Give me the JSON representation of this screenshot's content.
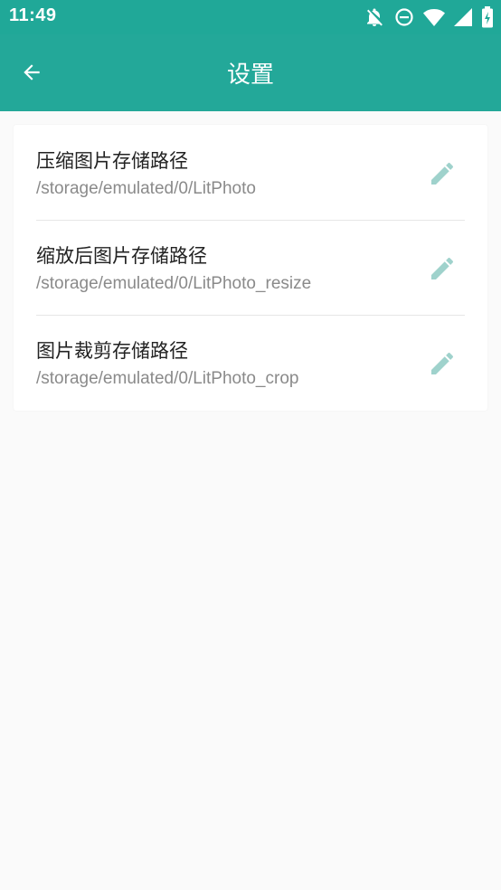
{
  "status_bar": {
    "time": "11:49",
    "icons": [
      "notifications-off-icon",
      "do-not-disturb-icon",
      "wifi-icon",
      "cellular-signal-icon",
      "battery-charging-icon"
    ]
  },
  "app_bar": {
    "title": "设置",
    "back_icon": "arrow-back-icon",
    "color": "#23a899"
  },
  "settings": [
    {
      "title": "压缩图片存储路径",
      "path": "/storage/emulated/0/LitPhoto",
      "icon": "edit-pencil-icon"
    },
    {
      "title": "缩放后图片存储路径",
      "path": "/storage/emulated/0/LitPhoto_resize",
      "icon": "edit-pencil-icon"
    },
    {
      "title": "图片裁剪存储路径",
      "path": "/storage/emulated/0/LitPhoto_crop",
      "icon": "edit-pencil-icon"
    }
  ],
  "colors": {
    "primary": "#23a899",
    "edit_icon": "#9fd2cc",
    "background": "#fafafa"
  }
}
